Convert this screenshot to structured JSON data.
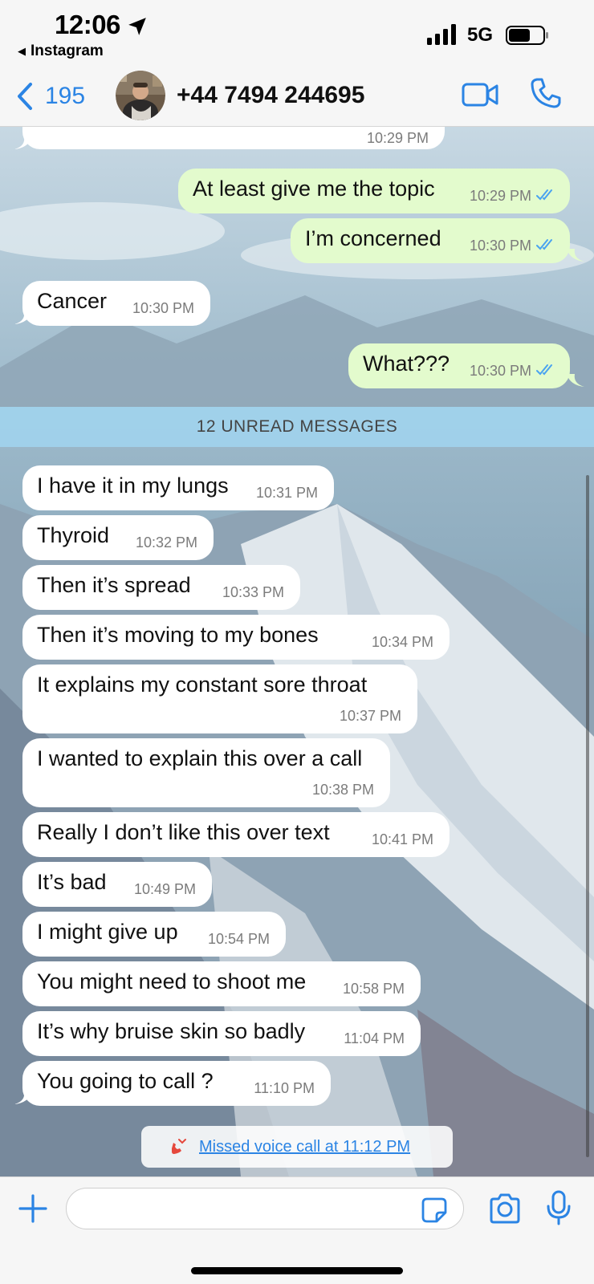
{
  "status_bar": {
    "time": "12:06",
    "back_app": "Instagram",
    "network": "5G"
  },
  "header": {
    "back_count": "195",
    "contact": "+44 7494 244695"
  },
  "messages": [
    {
      "dir": "in",
      "text": "",
      "time": "10:29 PM"
    },
    {
      "dir": "out",
      "text": "At least give me the topic",
      "time": "10:29 PM",
      "read": true
    },
    {
      "dir": "out",
      "text": "I’m concerned",
      "time": "10:30 PM",
      "read": true
    },
    {
      "dir": "in",
      "text": "Cancer",
      "time": "10:30 PM"
    },
    {
      "dir": "out",
      "text": "What???",
      "time": "10:30 PM",
      "read": true
    },
    {
      "dir": "in",
      "text": "I have it in my lungs",
      "time": "10:31 PM"
    },
    {
      "dir": "in",
      "text": "Thyroid",
      "time": "10:32 PM"
    },
    {
      "dir": "in",
      "text": "Then it’s spread",
      "time": "10:33 PM"
    },
    {
      "dir": "in",
      "text": "Then it’s moving to my bones",
      "time": "10:34 PM"
    },
    {
      "dir": "in",
      "text": "It explains my constant sore throat",
      "time": "10:37 PM"
    },
    {
      "dir": "in",
      "text": "I wanted to explain this over a call",
      "time": "10:38 PM"
    },
    {
      "dir": "in",
      "text": "Really I don’t like this over text",
      "time": "10:41 PM"
    },
    {
      "dir": "in",
      "text": "It’s bad",
      "time": "10:49 PM"
    },
    {
      "dir": "in",
      "text": "I might give up",
      "time": "10:54 PM"
    },
    {
      "dir": "in",
      "text": "You might need to shoot me",
      "time": "10:58 PM"
    },
    {
      "dir": "in",
      "text": "It’s why bruise skin so badly",
      "time": "11:04 PM"
    },
    {
      "dir": "in",
      "text": "You going to call  ?",
      "time": "11:10 PM"
    }
  ],
  "unread_label": "12 UNREAD MESSAGES",
  "missed_call": "Missed voice call at 11:12 PM",
  "input": {
    "value": "",
    "placeholder": ""
  },
  "colors": {
    "accent": "#2b84e4",
    "outgoing_bubble": "#e3fbcd",
    "incoming_bubble": "#ffffff",
    "missed_call_icon": "#e5483c"
  },
  "icons": {
    "location": "location-arrow-icon",
    "signal": "signal-bars-icon",
    "battery": "battery-icon",
    "back": "chevron-left-icon",
    "video": "video-camera-icon",
    "phone": "phone-icon",
    "ticks": "double-check-icon",
    "missed_call": "missed-call-icon",
    "plus": "plus-icon",
    "sticker": "sticker-icon",
    "camera": "camera-icon",
    "mic": "microphone-icon"
  }
}
